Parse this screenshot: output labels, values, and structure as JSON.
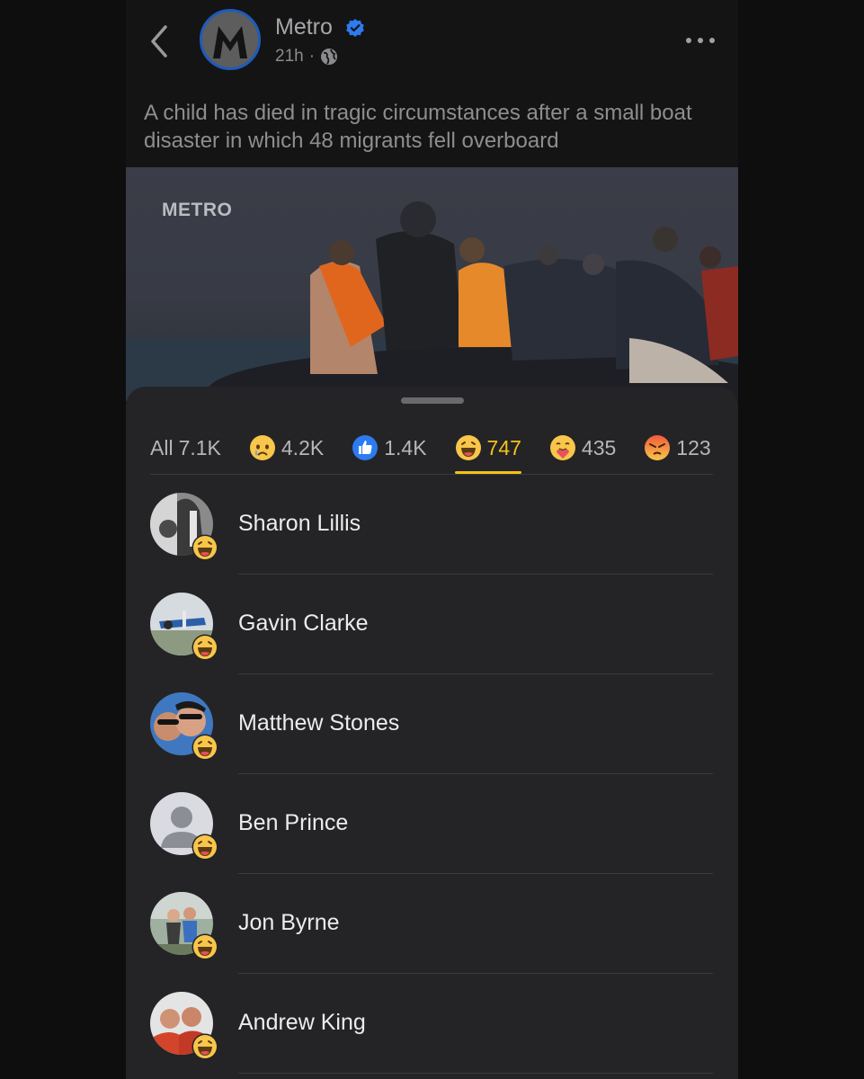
{
  "post": {
    "page_name": "Metro",
    "time": "21h",
    "separator": "·",
    "caption": "A child has died in tragic circumstances after a small boat disaster in which 48 migrants fell overboard",
    "watermark": "METRO"
  },
  "icons": {
    "back": "chevron-left-icon",
    "verified": "verified-badge-icon",
    "audience": "globe-icon",
    "more": "more-horizontal-icon"
  },
  "colors": {
    "accent": "#f4c21b",
    "verified": "#2d7bf0",
    "like": "#2d7bf0"
  },
  "reactions": {
    "tabs": [
      {
        "label": "All",
        "count": "7.1K"
      },
      {
        "label": "sad",
        "count": "4.2K"
      },
      {
        "label": "like",
        "count": "1.4K"
      },
      {
        "label": "haha",
        "count": "747"
      },
      {
        "label": "care",
        "count": "435"
      },
      {
        "label": "angry",
        "count": "123"
      }
    ],
    "active_tab": "haha",
    "people": [
      {
        "name": "Sharon Lillis"
      },
      {
        "name": "Gavin Clarke"
      },
      {
        "name": "Matthew Stones"
      },
      {
        "name": "Ben Prince"
      },
      {
        "name": "Jon Byrne"
      },
      {
        "name": "Andrew King"
      }
    ]
  }
}
